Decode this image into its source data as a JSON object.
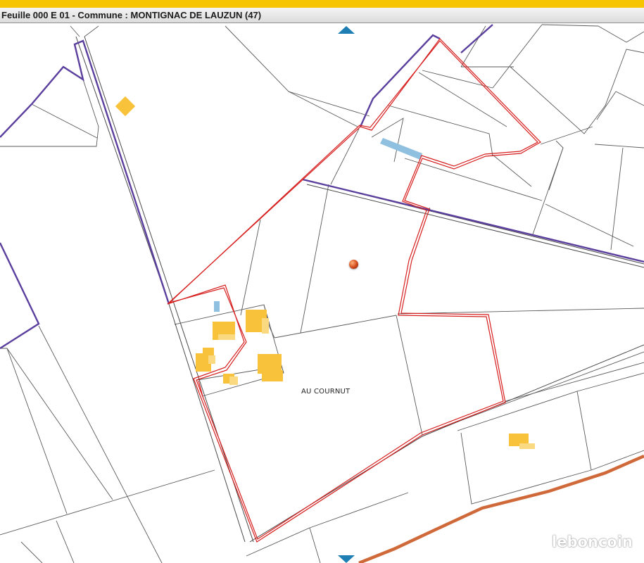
{
  "header": {
    "title": "Feuille 000 E 01 - Commune : MONTIGNAC DE LAUZUN (47)"
  },
  "map": {
    "place_label": "AU COURNUT",
    "colors": {
      "parcel_line": "#5a5a5a",
      "section_boundary": "#5b3f9e",
      "selected_parcel": "#d71e1e",
      "building": "#f8c23a",
      "water": "#8fc0df",
      "road": "#d0693a",
      "pan_arrow": "#1f7fb4",
      "header_accent": "#f7c400"
    },
    "controls": {
      "pan_up_icon": "triangle-up-icon",
      "pan_down_icon": "triangle-down-icon",
      "location_marker_icon": "location-dot-icon"
    }
  },
  "watermark": {
    "text": "leboncoin"
  }
}
